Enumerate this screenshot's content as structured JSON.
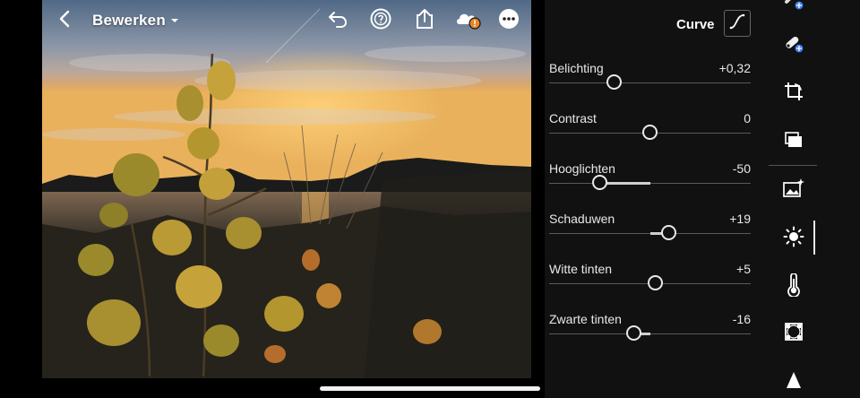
{
  "topbar": {
    "title": "Bewerken",
    "icons": [
      "back-icon",
      "undo-icon",
      "help-icon",
      "share-icon",
      "cloud-sync-warning-icon",
      "more-icon"
    ]
  },
  "panel": {
    "curve_label": "Curve",
    "sliders": [
      {
        "label": "Belichting",
        "value": "+0,32",
        "position": 0.32,
        "fill_from": 0.5,
        "fill_to": 0.5
      },
      {
        "label": "Contrast",
        "value": "0",
        "position": 0.5,
        "fill_from": 0.5,
        "fill_to": 0.5
      },
      {
        "label": "Hooglichten",
        "value": "-50",
        "position": 0.25,
        "fill_from": 0.25,
        "fill_to": 0.5
      },
      {
        "label": "Schaduwen",
        "value": "+19",
        "position": 0.595,
        "fill_from": 0.5,
        "fill_to": 0.595
      },
      {
        "label": "Witte tinten",
        "value": "+5",
        "position": 0.525,
        "fill_from": 0.5,
        "fill_to": 0.525
      },
      {
        "label": "Zwarte tinten",
        "value": "-16",
        "position": 0.42,
        "fill_from": 0.42,
        "fill_to": 0.5
      }
    ]
  },
  "rail": {
    "icons": [
      "heal-badge-icon",
      "brush-badge-icon",
      "crop-icon",
      "presets-icon",
      "auto-enhance-icon",
      "light-icon",
      "temperature-icon",
      "vignette-icon",
      "detail-icon"
    ],
    "active": "light-icon"
  },
  "colors": {
    "panel_bg": "#111112",
    "accent": "#e8e8e8",
    "warning": "#e8852b",
    "badge": "#3b7ff5"
  }
}
